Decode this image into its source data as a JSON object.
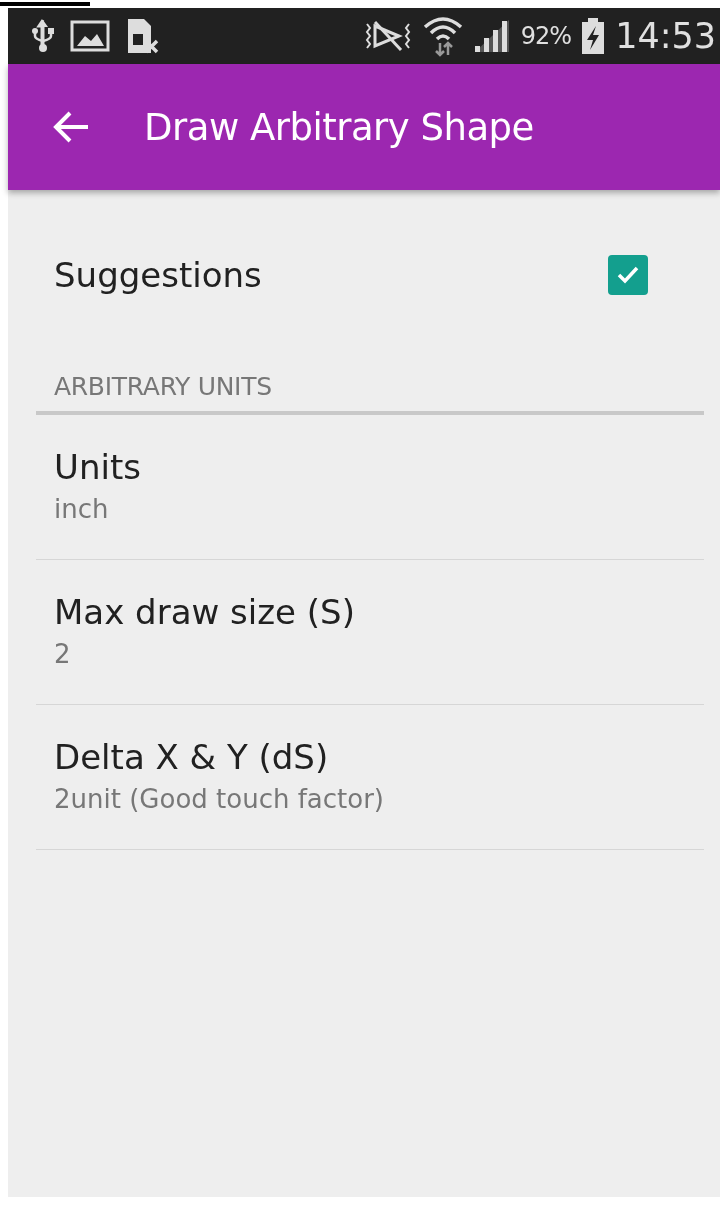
{
  "status_bar": {
    "battery": "92%",
    "time": "14:53"
  },
  "app_bar": {
    "title": "Draw Arbitrary Shape"
  },
  "suggestions": {
    "label": "Suggestions",
    "checked": true
  },
  "section": {
    "title": "ARBITRARY UNITS"
  },
  "preferences": [
    {
      "title": "Units",
      "summary": "inch"
    },
    {
      "title": "Max draw size (S)",
      "summary": "2"
    },
    {
      "title": "Delta X & Y (dS)",
      "summary": "2unit (Good touch factor)"
    }
  ]
}
